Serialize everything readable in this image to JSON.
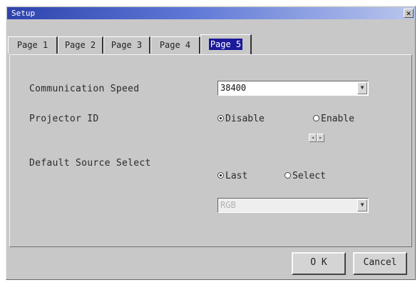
{
  "window": {
    "title": "Setup"
  },
  "tabs": [
    {
      "label": "Page 1"
    },
    {
      "label": "Page 2"
    },
    {
      "label": "Page 3"
    },
    {
      "label": "Page 4"
    },
    {
      "label": "Page 5",
      "active": true
    }
  ],
  "settings": {
    "comm_speed": {
      "label": "Communication Speed",
      "value": "38400"
    },
    "projector_id": {
      "label": "Projector ID",
      "options": [
        "Disable",
        "Enable"
      ],
      "selected": "Disable"
    },
    "default_source": {
      "label": "Default Source Select",
      "options": [
        "Last",
        "Select"
      ],
      "selected": "Last",
      "select_value": "RGB"
    }
  },
  "buttons": {
    "ok": "O K",
    "cancel": "Cancel"
  },
  "colors": {
    "titlebar_start": "#2d43ad",
    "titlebar_end": "#b9c6ee",
    "dialog_bg": "#c8c8c8",
    "active_tab_highlight": "#1a1a9a"
  }
}
